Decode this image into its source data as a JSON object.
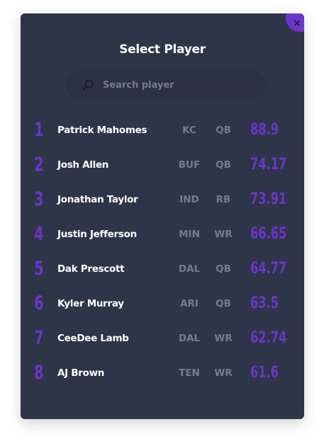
{
  "dialog": {
    "title": "Select Player",
    "close_label": "×"
  },
  "search": {
    "placeholder": "Search player",
    "value": "",
    "icon": "search-icon"
  },
  "players": [
    {
      "rank": "1",
      "name": "Patrick Mahomes",
      "team": "KC",
      "position": "QB",
      "score": "88.9"
    },
    {
      "rank": "2",
      "name": "Josh Allen",
      "team": "BUF",
      "position": "QB",
      "score": "74.17"
    },
    {
      "rank": "3",
      "name": "Jonathan Taylor",
      "team": "IND",
      "position": "RB",
      "score": "73.91"
    },
    {
      "rank": "4",
      "name": "Justin Jefferson",
      "team": "MIN",
      "position": "WR",
      "score": "66.65"
    },
    {
      "rank": "5",
      "name": "Dak Prescott",
      "team": "DAL",
      "position": "QB",
      "score": "64.77"
    },
    {
      "rank": "6",
      "name": "Kyler Murray",
      "team": "ARI",
      "position": "QB",
      "score": "63.5"
    },
    {
      "rank": "7",
      "name": "CeeDee Lamb",
      "team": "DAL",
      "position": "WR",
      "score": "62.74"
    },
    {
      "rank": "8",
      "name": "AJ Brown",
      "team": "TEN",
      "position": "WR",
      "score": "61.6"
    }
  ],
  "colors": {
    "panel": "#2f3548",
    "accent": "#6b35c9",
    "text": "#ffffff",
    "muted": "#747b8c"
  }
}
